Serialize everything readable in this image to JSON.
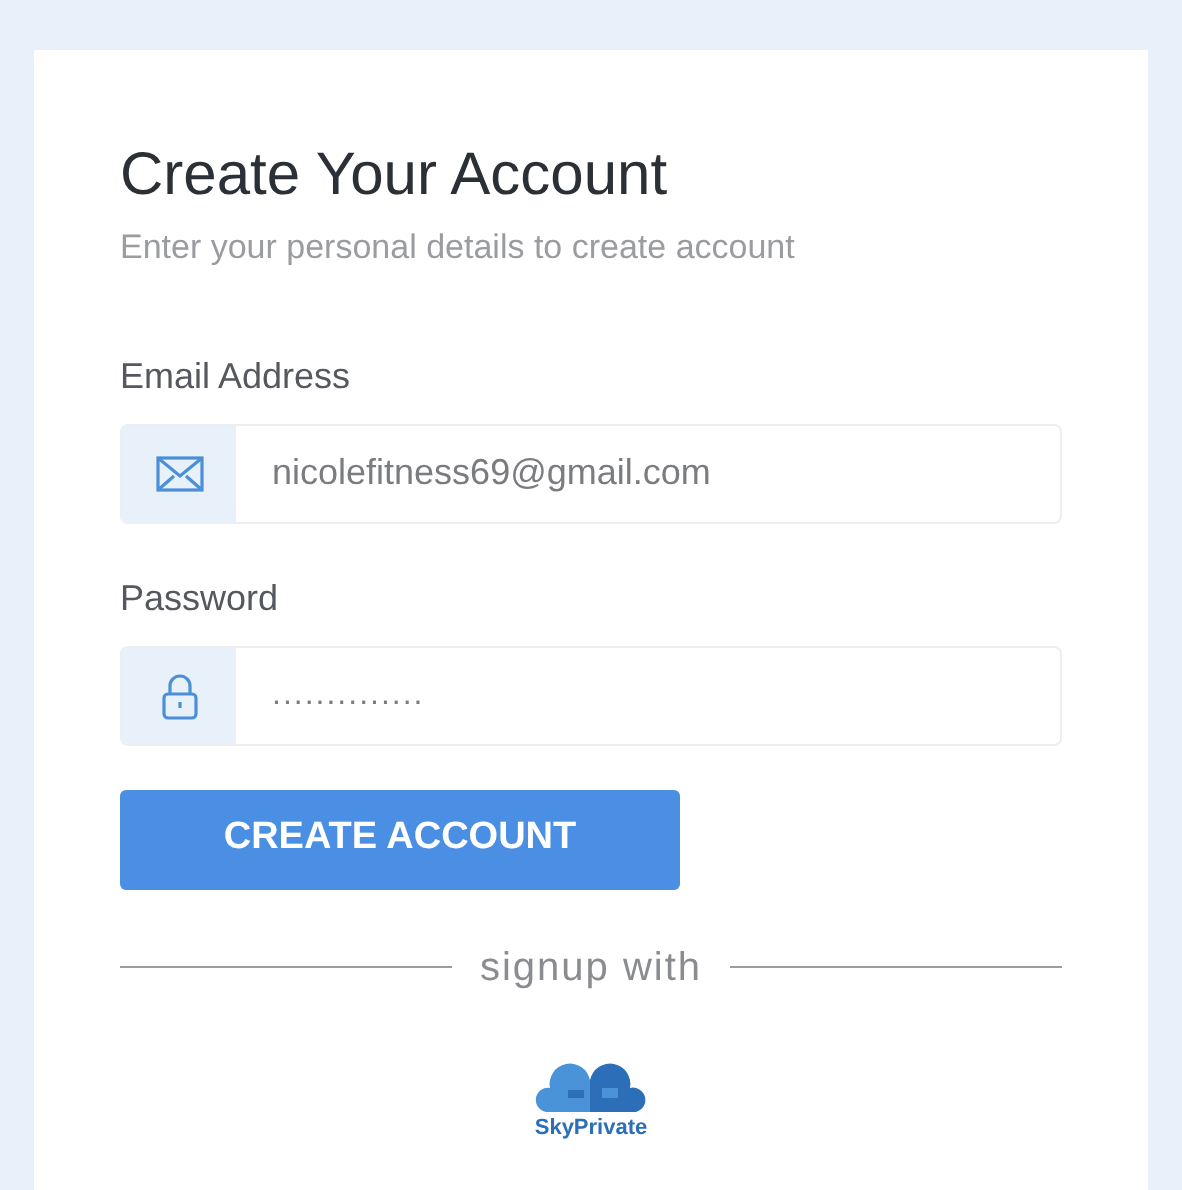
{
  "title": "Create Your Account",
  "subtitle": "Enter your personal details to create account",
  "fields": [
    {
      "kind": "email",
      "label": "Email Address",
      "value": "nicolefitness69@gmail.com"
    },
    {
      "kind": "password",
      "label": "Password",
      "value": ".............."
    }
  ],
  "button": "CREATE ACCOUNT",
  "divider": "signup with",
  "provider": "SkyPrivate"
}
